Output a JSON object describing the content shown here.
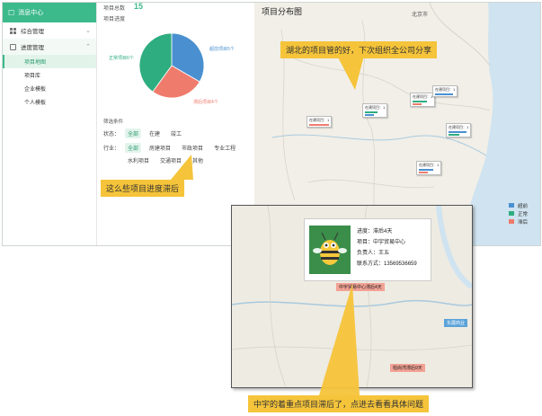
{
  "sidebar": {
    "title": "消息中心",
    "items": [
      {
        "label": "综合管理",
        "icon": "grid-icon"
      },
      {
        "label": "进度管理",
        "icon": "list-icon"
      }
    ],
    "subitems": [
      "项目地图",
      "项目库",
      "企业模板",
      "个人模板"
    ]
  },
  "stats": {
    "label": "项目总数",
    "value": "15",
    "progress_label": "项目进度"
  },
  "pie": {
    "slices": [
      {
        "label": "超前项目5个",
        "value": 5,
        "color": "#4a90d0"
      },
      {
        "label": "滞后项目4个",
        "value": 4,
        "color": "#ef7b6c"
      },
      {
        "label": "正常项目6个",
        "value": 6,
        "color": "#2ead80"
      }
    ]
  },
  "filter": {
    "title": "筛选条件",
    "status_label": "状态：",
    "status_options": [
      "全部",
      "在建",
      "竣工"
    ],
    "industry_label": "行业：",
    "industry_row1": [
      "全部",
      "房建项目",
      "市政项目",
      "专业工程"
    ],
    "industry_row2": [
      "水利项目",
      "交通项目",
      "其他"
    ]
  },
  "map": {
    "title": "项目分布图",
    "city_label": "北京市",
    "legend": [
      {
        "label": "超前",
        "color": "#4a90d0"
      },
      {
        "label": "正常",
        "color": "#2ead80"
      },
      {
        "label": "滞后",
        "color": "#ef7b6c"
      }
    ],
    "marker_text": "在建项目：1"
  },
  "notes": {
    "hubei": "湖北的项目管的好，下次组织全公司分享",
    "delay": "这么些项目进度滞后",
    "zhongyu": "中宇的着重点项目滞后了，点进去看看具体问题"
  },
  "popup": {
    "progress": "进度：滞后4天",
    "project": "项目：中宇贸易中心",
    "manager": "负责人：王五",
    "contact": "联系方式：13569536659",
    "tag1": "中宇贸易中心滞后4天",
    "tag2": "东展商业",
    "tag3": "柏尚湾滞后9天"
  }
}
